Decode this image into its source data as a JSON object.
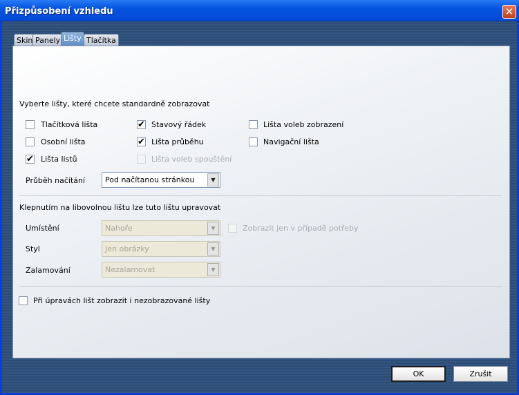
{
  "window": {
    "title": "Přizpůsobení vzhledu",
    "close_label": "✕"
  },
  "tabs": [
    {
      "label": "Skin"
    },
    {
      "label": "Panely"
    },
    {
      "label": "Lišty",
      "active": true
    },
    {
      "label": "Tlačítka"
    }
  ],
  "section1": {
    "heading": "Vyberte lišty, které chcete standardně zobrazovat",
    "checkboxes": [
      {
        "label": "Tlačítková lišta",
        "checked": false
      },
      {
        "label": "Stavový řádek",
        "checked": true
      },
      {
        "label": "Lišta voleb zobrazení",
        "checked": false
      },
      {
        "label": "Osobní lišta",
        "checked": false
      },
      {
        "label": "Lišta průběhu",
        "checked": true
      },
      {
        "label": "Navigační lišta",
        "checked": false
      },
      {
        "label": "Lišta listů",
        "checked": true
      },
      {
        "label": "Lišta voleb spouštění",
        "checked": false,
        "disabled": true
      }
    ],
    "progress_label": "Průběh načítání",
    "progress_value": "Pod načítanou stránkou"
  },
  "section2": {
    "heading": "Klepnutím na libovolnou lištu lze tuto lištu upravovat",
    "placement_label": "Umístění",
    "placement_value": "Nahoře",
    "show_if_needed_label": "Zobrazit jen v případě potřeby",
    "style_label": "Styl",
    "style_value": "Jen obrázky",
    "wrap_label": "Zalamování",
    "wrap_value": "Nezalamovat"
  },
  "bottom_checkbox": {
    "label": "Při úpravách lišt zobrazit i nezobrazované lišty",
    "checked": false
  },
  "buttons": {
    "ok": "OK",
    "cancel": "Zrušit"
  },
  "icons": {
    "check": "✔",
    "arrow": "▼"
  }
}
